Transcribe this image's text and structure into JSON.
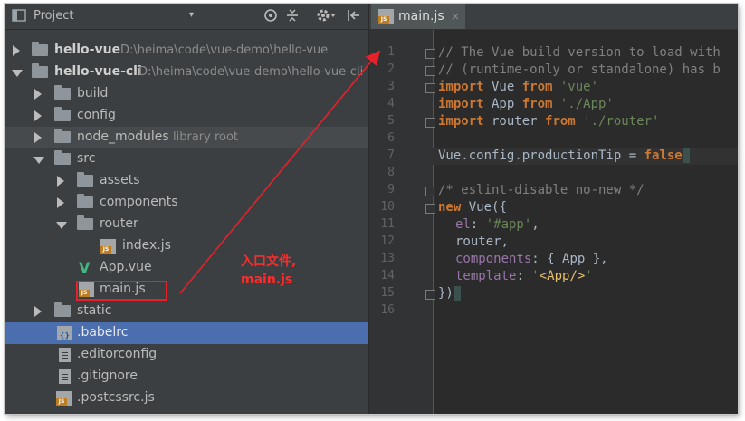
{
  "project": {
    "title": "Project",
    "dropdown": "▾",
    "icons": [
      "target-icon",
      "collapse-icon",
      "gear-icon",
      "hide-icon"
    ]
  },
  "tree": [
    {
      "label": "hello-vue",
      "sub": "D:\\heima\\code\\vue-demo\\hello-vue",
      "bold": true
    },
    {
      "label": "hello-vue-cli",
      "sub": "D:\\heima\\code\\vue-demo\\hello-vue-cli",
      "bold": true
    },
    {
      "label": "build"
    },
    {
      "label": "config"
    },
    {
      "label": "node_modules",
      "sub": "library root"
    },
    {
      "label": "src"
    },
    {
      "label": "assets"
    },
    {
      "label": "components"
    },
    {
      "label": "router"
    },
    {
      "label": "index.js"
    },
    {
      "label": "App.vue"
    },
    {
      "label": "main.js"
    },
    {
      "label": "static"
    },
    {
      "label": ".babelrc"
    },
    {
      "label": ".editorconfig"
    },
    {
      "label": ".gitignore"
    },
    {
      "label": ".postcssrc.js"
    }
  ],
  "editor": {
    "tab_label": "main.js",
    "close_glyph": "×",
    "line_numbers": [
      "1",
      "2",
      "3",
      "4",
      "5",
      "6",
      "7",
      "8",
      "9",
      "10",
      "11",
      "12",
      "13",
      "14",
      "15",
      "16"
    ],
    "code": {
      "l1": "// The Vue build version to load with",
      "l2": "// (runtime-only or standalone) has b",
      "l3_kw": "import",
      "l3_a": " Vue ",
      "l3_kw2": "from",
      "l3_s": " 'vue'",
      "l4_kw": "import",
      "l4_a": " App ",
      "l4_kw2": "from",
      "l4_s": " './App'",
      "l5_kw": "import",
      "l5_a": " router ",
      "l5_kw2": "from",
      "l5_s": " './router'",
      "l7_a": "Vue.config.productionTip = ",
      "l7_kw": "false",
      "l9": "/* eslint-disable no-new */",
      "l10_kw": "new",
      "l10_a": " Vue({",
      "l11_p": "el",
      "l11_a": ": ",
      "l11_s": "'#app'",
      "l11_b": ",",
      "l12": "router,",
      "l13_p": "components",
      "l13_a": ": { App },",
      "l14_p": "template",
      "l14_a": ": ",
      "l14_s1": "'",
      "l14_s2": "<App/>",
      "l14_s3": "'",
      "l15_a": "})"
    }
  },
  "annotation": {
    "line1": "入口文件,",
    "line2": "main.js",
    "color": "#ff2b2b"
  }
}
